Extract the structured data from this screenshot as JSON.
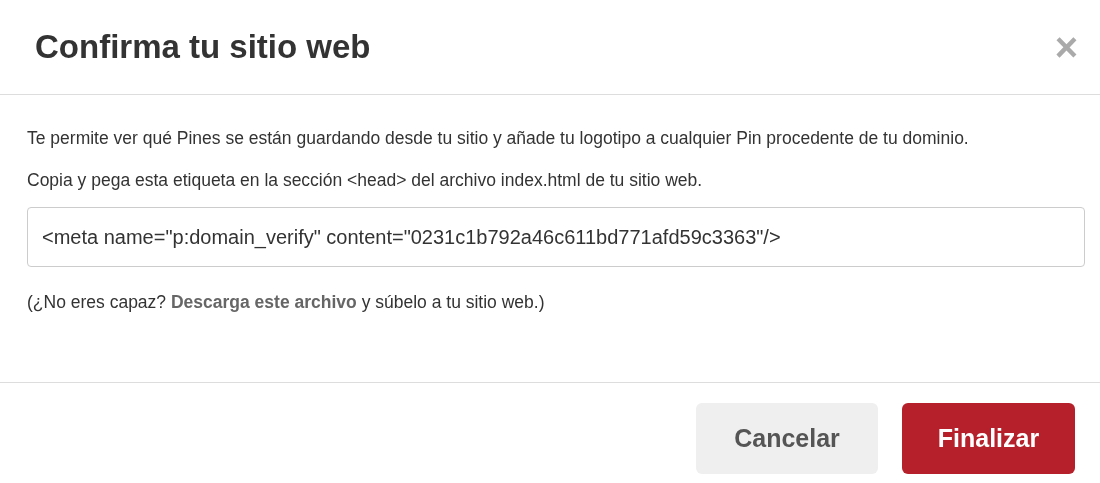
{
  "dialog": {
    "title": "Confirma tu sitio web",
    "close_label": "×"
  },
  "description": "Te permite ver qué Pines se están guardando desde tu sitio y añade tu logotipo a cualquier Pin procedente de tu dominio.",
  "instruction": "Copia y pega esta etiqueta en la sección <head> del archivo index.html de tu sitio web.",
  "meta_tag_field": {
    "value": "<meta name=\"p:domain_verify\" content=\"0231c1b792a46c611bd771afd59c3363\"/>"
  },
  "help": {
    "before": "(¿No eres capaz? ",
    "link": "Descarga este archivo",
    "after": " y súbelo a tu sitio web.)"
  },
  "buttons": [
    {
      "label": "Cancelar",
      "kind": "secondary"
    },
    {
      "label": "Finalizar",
      "kind": "primary"
    }
  ]
}
